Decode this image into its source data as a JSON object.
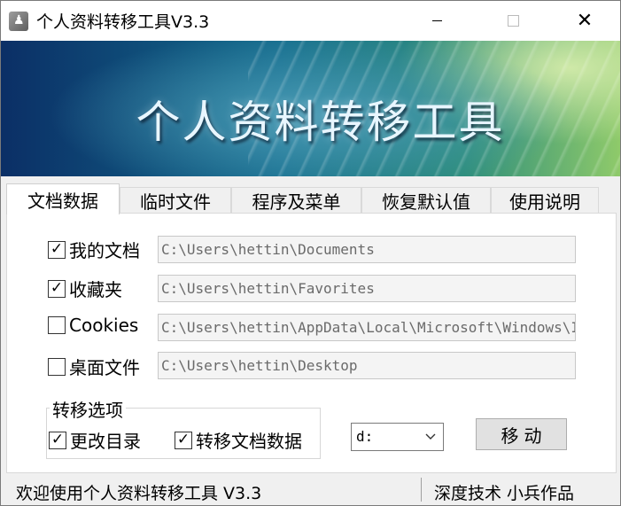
{
  "window": {
    "title": "个人资料转移工具V3.3",
    "icon": "app-icon",
    "controls": {
      "minimize": "minimize-icon",
      "maximize": "maximize-icon",
      "close": "✕"
    }
  },
  "banner": {
    "title": "个人资料转移工具"
  },
  "tabs": [
    {
      "label": "文档数据",
      "active": true
    },
    {
      "label": "临时文件",
      "active": false
    },
    {
      "label": "程序及菜单",
      "active": false
    },
    {
      "label": "恢复默认值",
      "active": false
    },
    {
      "label": "使用说明",
      "active": false
    }
  ],
  "items": [
    {
      "label": "我的文档",
      "checked": true,
      "path": "C:\\Users\\hettin\\Documents"
    },
    {
      "label": "收藏夹",
      "checked": true,
      "path": "C:\\Users\\hettin\\Favorites"
    },
    {
      "label": "Cookies",
      "checked": false,
      "path": "C:\\Users\\hettin\\AppData\\Local\\Microsoft\\Windows\\INetCookies"
    },
    {
      "label": "桌面文件",
      "checked": false,
      "path": "C:\\Users\\hettin\\Desktop"
    }
  ],
  "options": {
    "title": "转移选项",
    "change_dir": {
      "label": "更改目录",
      "checked": true
    },
    "move_docs": {
      "label": "转移文档数据",
      "checked": true
    }
  },
  "drive_select": {
    "value": "d:"
  },
  "move_button": {
    "label": "移动"
  },
  "status": {
    "left": "欢迎使用个人资料转移工具 V3.3",
    "right": "深度技术 小兵作品"
  },
  "colors": {
    "banner_start": "#0b2f66",
    "banner_end": "#8fca6a"
  }
}
